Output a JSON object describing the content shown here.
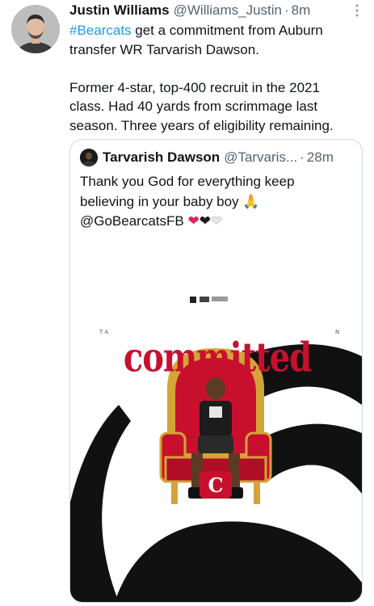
{
  "tweet": {
    "author_name": "Justin Williams",
    "author_handle": "@Williams_Justin",
    "separator": "·",
    "timestamp": "8m",
    "hashtag": "#Bearcats",
    "line1_rest": " get a commitment from Auburn",
    "line2": "transfer WR Tarvarish Dawson.",
    "para2_line1": "Former 4-star, top-400 recruit in the 2021",
    "para2_line2": "class. Had 40 yards from scrimmage last",
    "para2_line3": "season. Three years of eligibility remaining."
  },
  "quote": {
    "author_name": "Tarvarish Dawson",
    "author_handle": "@Tarvaris...",
    "separator": "·",
    "timestamp": "28m",
    "line1": "Thank you God for everything keep",
    "line2": "believing in your baby boy",
    "pray_emoji": "🙏",
    "line3": "@GoBearcatsFB",
    "heart_red": "❤",
    "heart_black": "❤",
    "heart_white": "❤"
  },
  "media": {
    "headline": "committed"
  },
  "icons": {
    "more": "more-icon",
    "verified": "none"
  },
  "colors": {
    "link": "#1d9bf0",
    "text": "#0f1419",
    "secondary": "#536471",
    "border": "#cfd9de",
    "graphic_red": "#c8102e"
  }
}
